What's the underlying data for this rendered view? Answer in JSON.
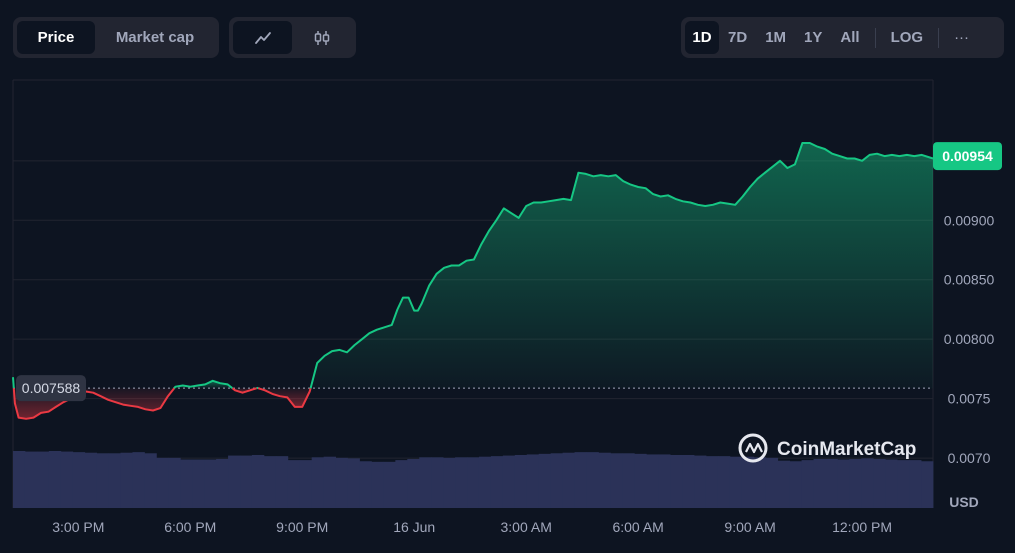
{
  "toolbar": {
    "type_tabs": [
      {
        "label": "Price",
        "active": true
      },
      {
        "label": "Market cap",
        "active": false
      }
    ],
    "style_icons": [
      {
        "icon": "line-chart-icon",
        "active": true
      },
      {
        "icon": "candlestick-icon",
        "active": false
      }
    ],
    "ranges": [
      {
        "label": "1D",
        "active": true
      },
      {
        "label": "7D",
        "active": false
      },
      {
        "label": "1M",
        "active": false
      },
      {
        "label": "1Y",
        "active": false
      },
      {
        "label": "All",
        "active": false
      }
    ],
    "log_label": "LOG",
    "more_label": "···"
  },
  "watermark": {
    "text": "CoinMarketCap",
    "icon": "coinmarketcap-logo-icon"
  },
  "colors": {
    "up": "#16c784",
    "down": "#ea3943",
    "volume": "#2b3258",
    "grid": "#222531",
    "current_tag": "#16c784",
    "open_tag": "#2f3443"
  },
  "chart_data": {
    "type": "line",
    "title": "",
    "xlabel": "",
    "ylabel": "",
    "currency_label": "USD",
    "scale": "linear",
    "grid": "horizontal",
    "open_price": 0.007588,
    "open_price_label": "0.007588",
    "current_price": 0.00954,
    "current_price_label": "0.00954",
    "ylim": [
      0.00658,
      0.01018
    ],
    "yticks": [
      {
        "value": 0.007,
        "label": "0.0070"
      },
      {
        "value": 0.0075,
        "label": "0.0075"
      },
      {
        "value": 0.008,
        "label": "0.00800"
      },
      {
        "value": 0.0085,
        "label": "0.00850"
      },
      {
        "value": 0.009,
        "label": "0.00900"
      }
    ],
    "xticks": [
      "3:00 PM",
      "6:00 PM",
      "9:00 PM",
      "16 Jun",
      "3:00 AM",
      "6:00 AM",
      "9:00 AM",
      "12:00 PM"
    ],
    "xtick_hours": [
      0,
      3,
      6,
      9,
      12,
      15,
      18,
      21
    ],
    "xrange_hours": [
      -1.75,
      22.9
    ],
    "series": [
      {
        "x_hours": [
          -1.75,
          -1.7,
          -1.6,
          -1.4,
          -1.2,
          -1.0,
          -0.8,
          -0.6,
          -0.4,
          -0.2,
          0.0,
          0.2,
          0.4,
          0.6,
          0.8,
          1.0,
          1.2,
          1.4,
          1.6,
          1.8,
          2.0,
          2.2,
          2.4,
          2.6,
          2.8,
          3.0,
          3.2,
          3.4,
          3.6,
          3.8,
          4.0,
          4.2,
          4.4,
          4.6,
          4.8,
          5.0,
          5.2,
          5.4,
          5.6,
          5.8,
          6.0,
          6.2,
          6.4,
          6.6,
          6.8,
          7.0,
          7.2,
          7.4,
          7.6,
          7.8,
          8.0,
          8.2,
          8.4,
          8.55,
          8.7,
          8.85,
          9.0,
          9.1,
          9.2,
          9.4,
          9.6,
          9.8,
          10.0,
          10.2,
          10.4,
          10.6,
          10.8,
          11.0,
          11.2,
          11.4,
          11.6,
          11.8,
          12.0,
          12.2,
          12.4,
          12.6,
          12.8,
          13.0,
          13.2,
          13.4,
          13.6,
          13.8,
          14.0,
          14.2,
          14.4,
          14.6,
          14.8,
          15.0,
          15.2,
          15.4,
          15.6,
          15.8,
          16.0,
          16.2,
          16.4,
          16.6,
          16.8,
          17.0,
          17.2,
          17.4,
          17.6,
          17.8,
          18.0,
          18.2,
          18.4,
          18.6,
          18.8,
          19.0,
          19.2,
          19.4,
          19.6,
          19.8,
          20.0,
          20.2,
          20.4,
          20.6,
          20.8,
          21.0,
          21.2,
          21.4,
          21.6,
          21.8,
          22.0,
          22.2,
          22.4,
          22.6,
          22.9
        ],
        "price": [
          0.00768,
          0.00746,
          0.00734,
          0.00733,
          0.00734,
          0.00738,
          0.00739,
          0.00743,
          0.00747,
          0.0075,
          0.00753,
          0.00756,
          0.00755,
          0.00752,
          0.00749,
          0.00747,
          0.00745,
          0.00744,
          0.00743,
          0.00741,
          0.0074,
          0.00742,
          0.00752,
          0.0076,
          0.00761,
          0.0076,
          0.00761,
          0.00762,
          0.00765,
          0.00763,
          0.00762,
          0.00757,
          0.00755,
          0.00757,
          0.00759,
          0.00757,
          0.00754,
          0.00752,
          0.00751,
          0.00743,
          0.00743,
          0.00756,
          0.0078,
          0.00786,
          0.0079,
          0.00791,
          0.00789,
          0.00795,
          0.008,
          0.00805,
          0.00808,
          0.0081,
          0.00812,
          0.00825,
          0.00835,
          0.00835,
          0.00824,
          0.00824,
          0.0083,
          0.00845,
          0.00855,
          0.0086,
          0.00862,
          0.00862,
          0.00866,
          0.00867,
          0.0088,
          0.00891,
          0.009,
          0.0091,
          0.00906,
          0.00902,
          0.00912,
          0.00915,
          0.00915,
          0.00916,
          0.00917,
          0.00918,
          0.00917,
          0.0094,
          0.00939,
          0.00937,
          0.00938,
          0.00937,
          0.00938,
          0.00933,
          0.0093,
          0.00928,
          0.00927,
          0.00922,
          0.0092,
          0.00921,
          0.00918,
          0.00916,
          0.00915,
          0.00913,
          0.00912,
          0.00913,
          0.00915,
          0.00914,
          0.00913,
          0.0092,
          0.00928,
          0.00935,
          0.0094,
          0.00945,
          0.0095,
          0.00944,
          0.00947,
          0.00965,
          0.00965,
          0.00962,
          0.0096,
          0.00956,
          0.00954,
          0.00952,
          0.00952,
          0.0095,
          0.00955,
          0.00956,
          0.00954,
          0.00955,
          0.00954,
          0.00955,
          0.00954,
          0.00955,
          0.00952
        ]
      }
    ],
    "volume_relative": [
      1.0,
      0.99,
      0.99,
      1.0,
      0.99,
      0.98,
      0.97,
      0.96,
      0.96,
      0.97,
      0.98,
      0.96,
      0.88,
      0.88,
      0.85,
      0.85,
      0.85,
      0.86,
      0.92,
      0.92,
      0.93,
      0.91,
      0.91,
      0.84,
      0.84,
      0.89,
      0.9,
      0.88,
      0.87,
      0.82,
      0.81,
      0.81,
      0.84,
      0.86,
      0.89,
      0.89,
      0.88,
      0.89,
      0.89,
      0.9,
      0.91,
      0.92,
      0.93,
      0.94,
      0.95,
      0.96,
      0.97,
      0.98,
      0.98,
      0.97,
      0.96,
      0.96,
      0.95,
      0.94,
      0.94,
      0.93,
      0.93,
      0.92,
      0.91,
      0.91,
      0.9,
      0.9,
      0.89,
      0.88,
      0.83,
      0.82,
      0.84,
      0.86,
      0.86,
      0.85,
      0.86,
      0.87,
      0.86,
      0.85,
      0.84,
      0.84,
      0.82
    ]
  }
}
